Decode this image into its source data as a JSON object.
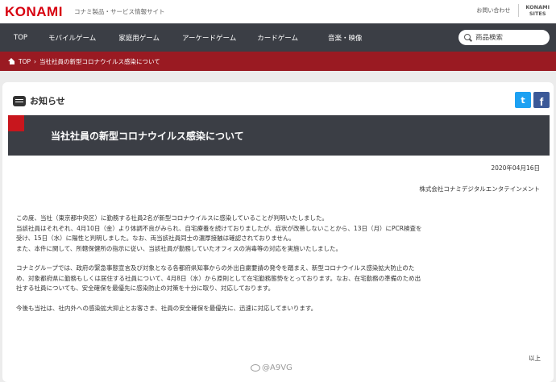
{
  "header": {
    "logo": "KONAMI",
    "tagline": "コナミ製品・サービス情報サイト",
    "contact": "お問い合わせ",
    "sites_line1": "KONAMI",
    "sites_line2": "SITES"
  },
  "nav": {
    "items": [
      "TOP",
      "モバイルゲーム",
      "家庭用ゲーム",
      "アーケードゲーム",
      "カードゲーム",
      "音楽・映像"
    ],
    "search_placeholder": "商品検索"
  },
  "breadcrumb": {
    "home": "TOP",
    "separator": "›",
    "current": "当社社員の新型コロナウイルス感染について"
  },
  "notice": {
    "label": "お知らせ",
    "twitter_glyph": "t",
    "facebook_glyph": "f"
  },
  "article": {
    "title": "当社社員の新型コロナウイルス感染について",
    "date": "2020年04月16日",
    "company": "株式会社コナミデジタルエンタテインメント",
    "para1": [
      "この度、当社（東京都中央区）に勤務する社員2名が新型コロナウイルスに感染していることが判明いたしました。",
      "当該社員はそれぞれ、4月10日（金）より体調不良がみられ、自宅療養を続けておりましたが、症状が改善しないことから、13日（月）にPCR検査を",
      "受け、15日（水）に陽性と判明しました。なお、両当該社員同士の濃厚接触は確認されておりません。",
      "また、本件に関して、所轄保健所の指示に従い、当該社員が勤務していたオフィスの消毒等の対応を実施いたしました。"
    ],
    "para2": [
      "コナミグループでは、政府の緊急事態宣言及び対象となる各都府県知事からの外出自粛要請の発令を踏まえ、新型コロナウイルス感染拡大防止のた",
      "め、対象都府県に勤務もしくは居住する社員について、4月8日（水）から原則として在宅勤務態勢をとっております。なお、在宅勤務の準備のため出",
      "社する社員についても、安全確保を最優先に感染防止の対策を十分に取り、対応しております。"
    ],
    "para3": [
      "今後も当社は、社内外への感染拡大抑止とお客さま、社員の安全確保を最優先に、迅速に対応してまいります。"
    ],
    "ending": "以上"
  },
  "watermark": "@A9VG",
  "colors": {
    "brand_red": "#d7000f",
    "nav_bg": "#3b3e45",
    "breadcrumb_bg": "#9a1a22",
    "twitter": "#1da1f2",
    "facebook": "#3b5998"
  }
}
